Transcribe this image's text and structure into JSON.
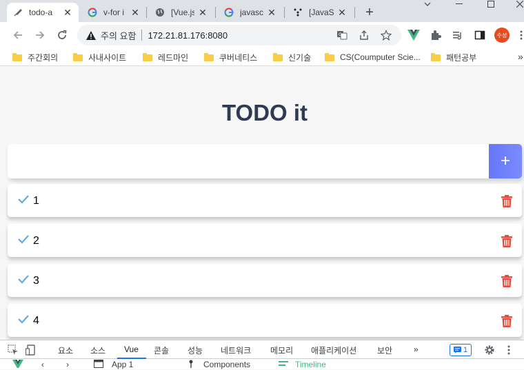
{
  "browser": {
    "tabs": [
      {
        "title": "todo-a",
        "icon": "todo-favicon"
      },
      {
        "title": "v-for i",
        "icon": "google-icon"
      },
      {
        "title": "[Vue.js",
        "icon": "globe-icon"
      },
      {
        "title": "javascr",
        "icon": "google-icon"
      },
      {
        "title": "[JavaSc",
        "icon": "velog-icon"
      }
    ],
    "new_tab": "+",
    "security_label": "주의 요함",
    "url": "172.21.81.176:8080",
    "profile_label": "수성"
  },
  "bookmarks": [
    "주간회의",
    "사내사이트",
    "레드마인",
    "쿠버네티스",
    "신기술",
    "CS(Coumputer Scie...",
    "패턴공부"
  ],
  "bookmarks_more": "»",
  "app": {
    "title": "TODO it",
    "input_value": "",
    "add_symbol": "+",
    "todos": [
      "1",
      "2",
      "3",
      "4"
    ],
    "colors": {
      "accent": "#6478fb",
      "check": "#62acde",
      "trash": "#e74c3c",
      "title": "#2f3b52"
    }
  },
  "devtools": {
    "tabs": [
      "요소",
      "소스",
      "Vue",
      "콘솔",
      "성능",
      "네트워크",
      "메모리",
      "애플리케이션",
      "보안",
      "»"
    ],
    "active_tab": "Vue",
    "issues_count": "1",
    "sub": {
      "app_label": "App 1",
      "components_label": "Components",
      "timeline_label": "Timeline"
    }
  }
}
